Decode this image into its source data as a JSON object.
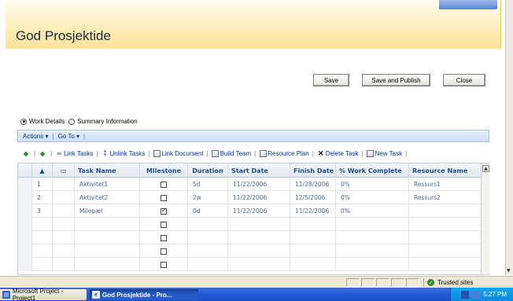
{
  "page": {
    "title": "God Prosjektide"
  },
  "buttons": {
    "save": "Save",
    "save_publish": "Save and Publish",
    "close": "Close"
  },
  "view_options": {
    "selected": "Work Details",
    "options": [
      "Work Details",
      "Summary Information"
    ]
  },
  "actions_bar": {
    "actions": "Actions",
    "goto": "Go To"
  },
  "toolbar": {
    "link_tasks": "Link Tasks",
    "unlink_tasks": "Unlink Tasks",
    "link_document": "Link Document",
    "build_team": "Build Team",
    "resource_plan": "Resource Plan",
    "delete_task": "Delete Task",
    "new_task": "New Task"
  },
  "grid": {
    "columns": {
      "sort": "▲",
      "task_name": "Task Name",
      "milestone": "Milestone",
      "duration": "Duration",
      "start_date": "Start Date",
      "finish_date": "Finish Date",
      "work_complete": "% Work Complete",
      "resource_name": "Resource Name"
    },
    "rows": [
      {
        "num": "1",
        "task_name": "Aktivitet1",
        "milestone": false,
        "duration": "5d",
        "start_date": "11/22/2006",
        "finish_date": "11/28/2006",
        "work_complete": "0%",
        "resource_name": "Ressurs1"
      },
      {
        "num": "2",
        "task_name": "Aktivitet2",
        "milestone": false,
        "duration": "2w",
        "start_date": "11/22/2006",
        "finish_date": "12/5/2006",
        "work_complete": "0%",
        "resource_name": "Ressurs2"
      },
      {
        "num": "3",
        "task_name": "Milepæl",
        "milestone": true,
        "duration": "0d",
        "start_date": "11/22/2006",
        "finish_date": "11/22/2006",
        "work_complete": "0%",
        "resource_name": ""
      }
    ]
  },
  "statusbar": {
    "zone": "Trusted sites"
  },
  "taskbar": {
    "items": [
      "Microsoft Project - Project1",
      "God Prosjektide - Pro..."
    ],
    "clock": "5:27 PM"
  },
  "colors": {
    "title_band": "#ffe29a",
    "link_blue": "#003399",
    "header_text": "#1f4e8c",
    "taskbar": "#245edb"
  }
}
